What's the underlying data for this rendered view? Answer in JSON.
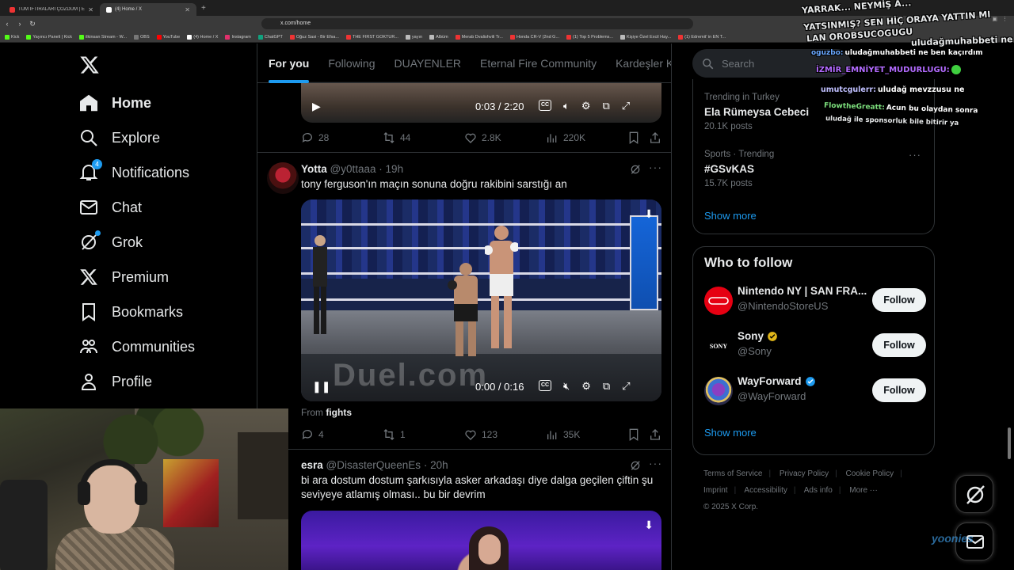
{
  "browser": {
    "tabs": [
      {
        "label": "TÜM İFTİRALARI ÇÖZDÜM | ENES BA",
        "active": false
      },
      {
        "label": "(4) Home / X",
        "active": true
      }
    ],
    "url": "x.com/home",
    "bookmarks": [
      "Kick",
      "Yayıncı Paneli | Kick",
      "ilkinsan Stream - W...",
      "OBS",
      "YouTube",
      "(4) Home / X",
      "Instagram",
      "ChatGPT",
      "Oğuz Sasi - Bir Efsa...",
      "THE FIRST GOKTUR...",
      "yayın",
      "Albüm",
      "Merab Dvalishvili Tr...",
      "Honda CR-V (2nd G...",
      "(1) Top 5 Problems...",
      "Kişiye Özel Excil Hay...",
      "(1) Edremit' in EN T..."
    ]
  },
  "nav": {
    "items": [
      {
        "label": "Home",
        "icon": "home-icon"
      },
      {
        "label": "Explore",
        "icon": "search-icon"
      },
      {
        "label": "Notifications",
        "icon": "bell-icon",
        "badge": "4"
      },
      {
        "label": "Chat",
        "icon": "mail-icon"
      },
      {
        "label": "Grok",
        "icon": "grok-icon"
      },
      {
        "label": "Premium",
        "icon": "x-icon"
      },
      {
        "label": "Bookmarks",
        "icon": "bookmark-icon"
      },
      {
        "label": "Communities",
        "icon": "communities-icon"
      },
      {
        "label": "Profile",
        "icon": "profile-icon"
      }
    ]
  },
  "timeline": {
    "tabs": [
      "For you",
      "Following",
      "DUAYENLER",
      "Eternal Fire Community",
      "Kardeşler K"
    ],
    "post0": {
      "video_time": "0:03 / 2:20",
      "replies": "28",
      "reposts": "44",
      "likes": "2.8K",
      "views": "220K"
    },
    "post1": {
      "name": "Yotta",
      "handle": "@y0ttaaa",
      "time": "19h",
      "text": "tony ferguson'ın maçın sonuna doğru rakibini sarstığı an",
      "video_time": "0:00 / 0:16",
      "video_watermark": "Duel.com",
      "from_label": "From",
      "from_source": "fights",
      "replies": "4",
      "reposts": "1",
      "likes": "123",
      "views": "35K"
    },
    "post2": {
      "name": "esra",
      "handle": "@DisasterQueenEs",
      "time": "20h",
      "text": "bi ara dostum dostum şarkısıyla asker arkadaşı diye dalga geçilen çiftin şu seviyeye atlamış olması.. bu bir devrim"
    }
  },
  "sidebar": {
    "search_placeholder": "Search",
    "trends": [
      {
        "meta": "Trending in Turkey",
        "name": "Ela Rümeysa Cebeci",
        "posts": "20.1K posts"
      },
      {
        "meta": "Sports · Trending",
        "name": "#GSvKAS",
        "posts": "15.7K posts"
      }
    ],
    "show_more": "Show more",
    "who_to_follow_title": "Who to follow",
    "who_to_follow": [
      {
        "name": "Nintendo NY | SAN FRA...",
        "handle": "@NintendoStoreUS",
        "verified": "none"
      },
      {
        "name": "Sony",
        "handle": "@Sony",
        "verified": "gold"
      },
      {
        "name": "WayForward",
        "handle": "@WayForward",
        "verified": "blue"
      }
    ],
    "follow_label": "Follow",
    "show_more_2": "Show more",
    "footer": [
      "Terms of Service",
      "Privacy Policy",
      "Cookie Policy",
      "Imprint",
      "Accessibility",
      "Ads info",
      "More ···",
      "© 2025 X Corp."
    ]
  },
  "stream": {
    "watermark": "yoonies",
    "chat": [
      {
        "user": "",
        "text": "YARRAK... NEYMİŞ A...",
        "color": "#ffffff"
      },
      {
        "user": "",
        "text": "YATSINMIŞ? SEN HİÇ ORAYA YATTIN MI",
        "color": "#ffffff"
      },
      {
        "user": "",
        "text": "LAN OROBSUCOGUGU",
        "color": "#ffffff"
      },
      {
        "user": "",
        "text": "uludağmuhabbeti ne ben kaçırdım",
        "color": "#ffffff"
      },
      {
        "user": "oguzbo:",
        "text": "uludağmuhabbeti ne ben kaçırdım",
        "color": "#6aa8ff"
      },
      {
        "user": "İZMİR_EMNİYET_MUDURLUGU:",
        "text": "",
        "color": "#b36bff"
      },
      {
        "user": "umutcgulerr:",
        "text": "uludağ mevzzusu ne",
        "color": "#c0c0ff"
      },
      {
        "user": "FlowtheGreatt:",
        "text": "Acun bu olaydan sonra",
        "color": "#7de07d"
      },
      {
        "user": "",
        "text": "uludağ ile sponsorluk bile bitirir ya",
        "color": "#ffffff"
      }
    ]
  }
}
